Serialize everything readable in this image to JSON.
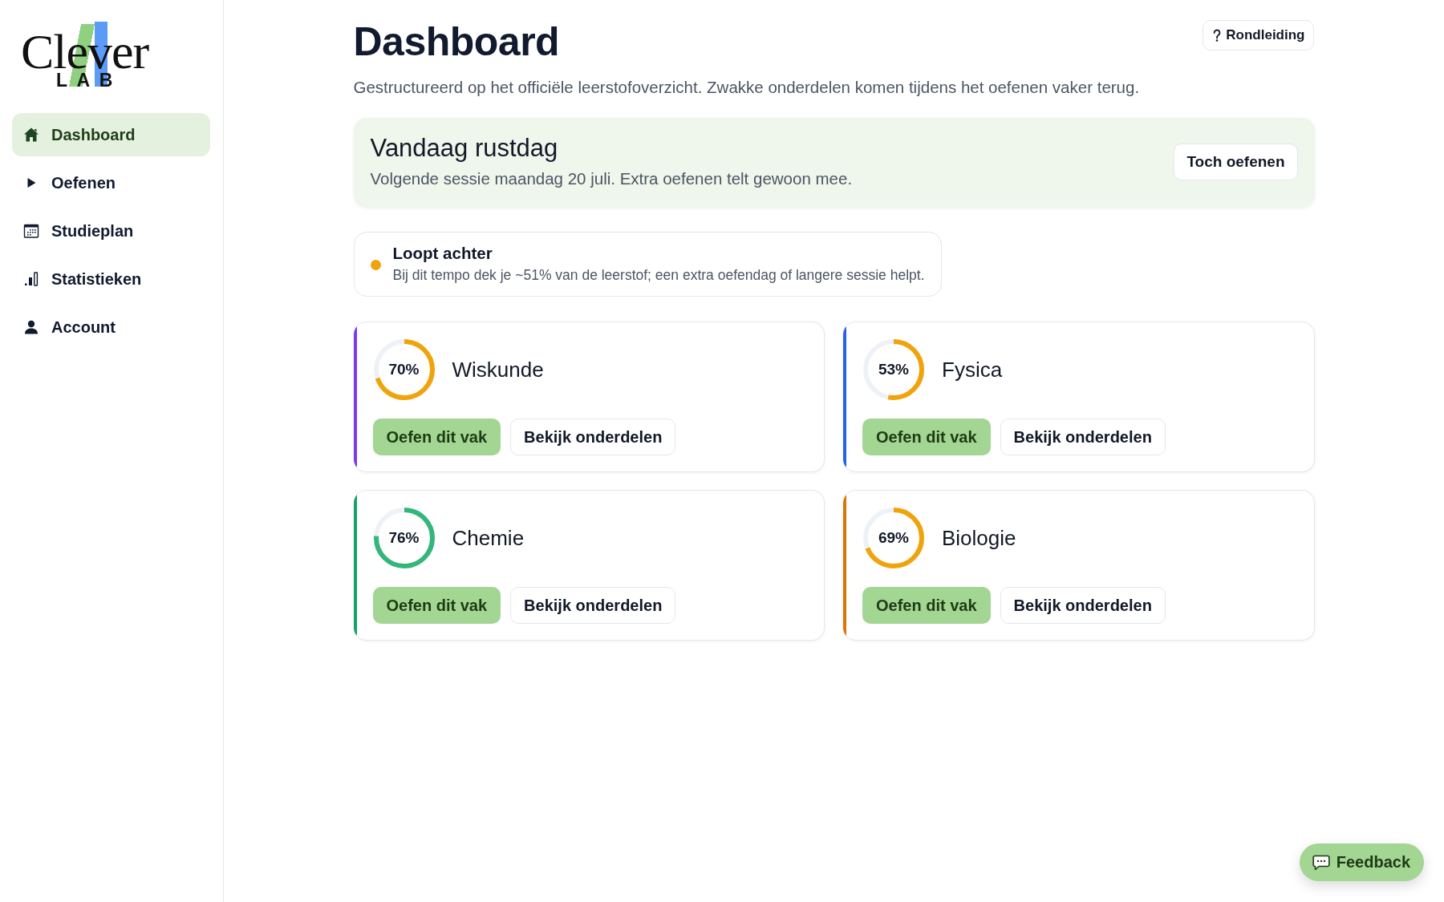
{
  "logo": {
    "word": "Clever",
    "subword": "LAB"
  },
  "sidebar": {
    "items": [
      {
        "label": "Dashboard",
        "selected": true
      },
      {
        "label": "Oefenen",
        "selected": false
      },
      {
        "label": "Studieplan",
        "selected": false
      },
      {
        "label": "Statistieken",
        "selected": false
      },
      {
        "label": "Account",
        "selected": false
      }
    ]
  },
  "header": {
    "title": "Dashboard",
    "subtitle": "Gestructureerd op het officiële leerstofoverzicht. Zwakke onderdelen komen tijdens het oefenen vaker terug.",
    "tour_button": "Rondleiding"
  },
  "rest_banner": {
    "title": "Vandaag rustdag",
    "text": "Volgende sessie maandag 20 juli. Extra oefenen telt gewoon mee.",
    "button": "Toch oefenen"
  },
  "alert": {
    "title": "Loopt achter",
    "text": "Bij dit tempo dek je ~51% van de leerstof; een extra oefendag of langere sessie helpt.",
    "color": "#f0a30a"
  },
  "subjects": [
    {
      "name": "Wiskunde",
      "percent": "70%",
      "level": 0.7,
      "color": "#7c3aed",
      "practice_button": "Oefen dit vak",
      "details_button": "Bekijk onderdelen"
    },
    {
      "name": "Fysica",
      "percent": "53%",
      "level": 0.53,
      "color": "#2563eb",
      "practice_button": "Oefen dit vak",
      "details_button": "Bekijk onderdelen"
    },
    {
      "name": "Chemie",
      "percent": "76%",
      "level": 0.76,
      "color": "#16a06a",
      "practice_button": "Oefen dit vak",
      "details_button": "Bekijk onderdelen"
    },
    {
      "name": "Biologie",
      "percent": "69%",
      "level": 0.69,
      "color": "#d97706",
      "practice_button": "Oefen dit vak",
      "details_button": "Bekijk onderdelen"
    }
  ],
  "feedback_button": "Feedback"
}
